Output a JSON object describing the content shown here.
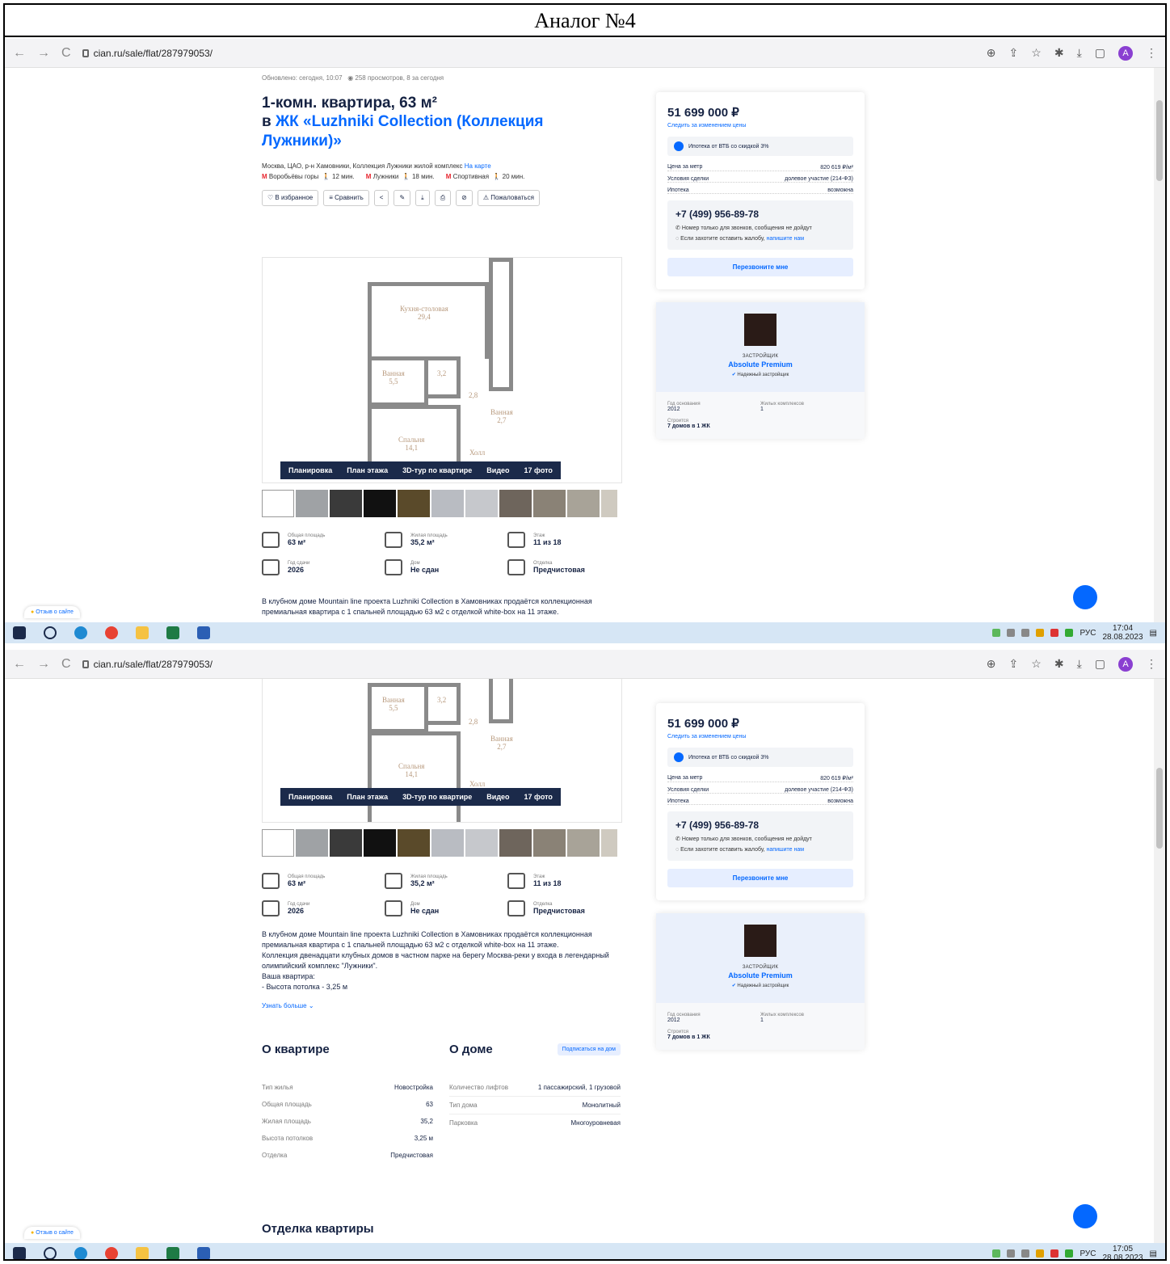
{
  "doc_title": "Аналог №4",
  "browser": {
    "url": "cian.ru/sale/flat/287979053/",
    "profile_initial": "A"
  },
  "listing": {
    "updated": "Обновлено: сегодня, 10:07",
    "views": "258 просмотров, 8 за сегодня",
    "title": "1-комн. квартира, 63 м²",
    "jk_prefix": "в ",
    "jk_name": "ЖК «Luzhniki Collection (Коллекция Лужники)»",
    "address": "Москва, ЦАО, р-н Хамовники, Коллекция Лужники жилой комплекс",
    "map_link": "На карте",
    "metro": [
      {
        "name": "Воробьёвы горы",
        "time": "12 мин."
      },
      {
        "name": "Лужники",
        "time": "18 мин."
      },
      {
        "name": "Спортивная",
        "time": "20 мин."
      }
    ],
    "actions": {
      "favorite": "В избранное",
      "compare": "Сравнить",
      "complain": "Пожаловаться"
    },
    "media_tabs": [
      "Планировка",
      "План этажа",
      "3D-тур по квартире",
      "Видео",
      "17 фото"
    ],
    "rooms": {
      "kitchen": "Кухня-столовая",
      "kitchen_area": "29,4",
      "bath": "Ванная",
      "bath_area": "5,5",
      "wardrobe_area": "3,2",
      "corridor_area": "2,8",
      "bath2": "Ванная",
      "bath2_area": "2,7",
      "bedroom": "Спальня",
      "bedroom_area": "14,1",
      "hall": "Холл"
    },
    "specs": [
      {
        "label": "Общая площадь",
        "value": "63 м²"
      },
      {
        "label": "Жилая площадь",
        "value": "35,2 м²"
      },
      {
        "label": "Этаж",
        "value": "11 из 18"
      },
      {
        "label": "Год сдачи",
        "value": "2026"
      },
      {
        "label": "Дом",
        "value": "Не сдан"
      },
      {
        "label": "Отделка",
        "value": "Предчистовая"
      }
    ],
    "desc_lines": [
      "В клубном доме Mountain line проекта Luzhniki Collection в Хамовниках продаётся коллекционная",
      "премиальная квартира с 1 спальней площадью 63 м2 с отделкой white-box на 11 этаже.",
      "Коллекция двенадцати клубных домов в частном парке на берегу Москва-реки у входа в легендарный",
      "олимпийский комплекс \"Лужники\".",
      "Ваша квартира:",
      "-     Высота потолка - 3,25 м"
    ],
    "more": "Узнать больше",
    "about_flat": {
      "title": "О квартире",
      "rows": [
        {
          "k": "Тип жилья",
          "v": "Новостройка"
        },
        {
          "k": "Общая площадь",
          "v": "63"
        },
        {
          "k": "Жилая площадь",
          "v": "35,2"
        },
        {
          "k": "Высота потолков",
          "v": "3,25 м"
        },
        {
          "k": "Отделка",
          "v": "Предчистовая"
        }
      ]
    },
    "about_house": {
      "title": "О доме",
      "subscribe": "Подписаться на дом",
      "rows": [
        {
          "k": "Количество лифтов",
          "v": "1 пассажирский, 1 грузовой"
        },
        {
          "k": "Тип дома",
          "v": "Монолитный"
        },
        {
          "k": "Парковка",
          "v": "Многоуровневая"
        }
      ]
    },
    "finish_title": "Отделка квартиры"
  },
  "price_card": {
    "price": "51 699 000 ₽",
    "follow": "Следить за изменением цены",
    "mortgage": "Ипотека от ВТБ со скидкой 3%",
    "rows": [
      {
        "k": "Цена за метр",
        "v": "820 619 ₽/м²"
      },
      {
        "k": "Условия сделки",
        "v": "долевое участие (214-ФЗ)"
      },
      {
        "k": "Ипотека",
        "v": "возможна"
      }
    ],
    "phone": "+7 (499) 956-89-78",
    "note1": "Номер только для звонков, сообщения не дойдут",
    "note2": "Если захотите оставить жалобу,",
    "note2_link": "напишите нам",
    "callback": "Перезвоните мне"
  },
  "developer": {
    "kind": "ЗАСТРОЙЩИК",
    "name": "Absolute Premium",
    "reliable": "Надежный застройщик",
    "founded_label": "Год основания",
    "founded": "2012",
    "complexes_label": "Жилых комплексов",
    "complexes": "1",
    "building_label": "Строится",
    "building": "7 домов в 1 ЖК"
  },
  "feedback": "Отзыв о сайте",
  "taskbar": {
    "lang": "РУС",
    "time1": "17:04",
    "time2": "17:05",
    "date": "28.08.2023"
  }
}
